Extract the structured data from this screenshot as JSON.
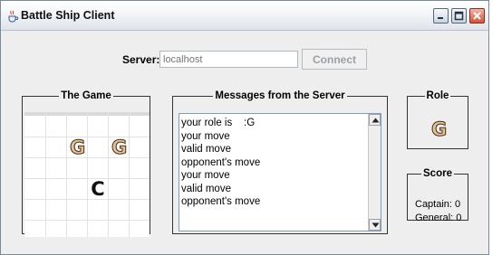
{
  "window": {
    "title": "Battle Ship Client",
    "app_icon": "java-cup-icon"
  },
  "server": {
    "label": "Server:",
    "placeholder": "localhost",
    "value": "",
    "connect_label": "Connect",
    "connect_enabled": false
  },
  "game": {
    "title": "The Game",
    "pieces": [
      {
        "label": "G",
        "kind": "general"
      },
      {
        "label": "G",
        "kind": "general"
      },
      {
        "label": "C",
        "kind": "captain"
      }
    ]
  },
  "messages": {
    "title": "Messages from the Server",
    "lines": [
      "your role is    :G",
      "your move",
      "valid move",
      "opponent's move",
      "your move",
      "valid move",
      "opponent's move"
    ]
  },
  "role": {
    "title": "Role",
    "value": "G"
  },
  "score": {
    "title": "Score",
    "captain": "Captain: 0",
    "general": "General: 0"
  },
  "colors": {
    "window_bg": "#eeeeee",
    "general_piece_fill": "#e1c09a",
    "captain_piece_fill": "#111111",
    "close_button": "#d4523d"
  }
}
